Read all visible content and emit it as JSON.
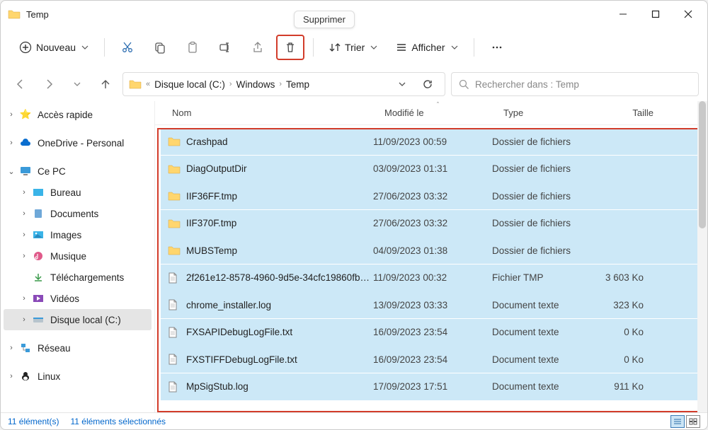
{
  "window": {
    "title": "Temp"
  },
  "tooltip": "Supprimer",
  "toolbar": {
    "new_label": "Nouveau",
    "sort_label": "Trier",
    "view_label": "Afficher"
  },
  "breadcrumb": {
    "prefix": "«",
    "seg1": "Disque local (C:)",
    "seg2": "Windows",
    "seg3": "Temp"
  },
  "search": {
    "placeholder": "Rechercher dans : Temp"
  },
  "sidebar": {
    "quick": "Accès rapide",
    "onedrive": "OneDrive - Personal",
    "thispc": "Ce PC",
    "desktop": "Bureau",
    "documents": "Documents",
    "images": "Images",
    "music": "Musique",
    "downloads": "Téléchargements",
    "videos": "Vidéos",
    "diskc": "Disque local (C:)",
    "network": "Réseau",
    "linux": "Linux"
  },
  "columns": {
    "name": "Nom",
    "modified": "Modifié le",
    "type": "Type",
    "size": "Taille"
  },
  "files": [
    {
      "name": "Crashpad",
      "modified": "11/09/2023 00:59",
      "type": "Dossier de fichiers",
      "size": "",
      "icon": "folder"
    },
    {
      "name": "DiagOutputDir",
      "modified": "03/09/2023 01:31",
      "type": "Dossier de fichiers",
      "size": "",
      "icon": "folder"
    },
    {
      "name": "IIF36FF.tmp",
      "modified": "27/06/2023 03:32",
      "type": "Dossier de fichiers",
      "size": "",
      "icon": "folder"
    },
    {
      "name": "IIF370F.tmp",
      "modified": "27/06/2023 03:32",
      "type": "Dossier de fichiers",
      "size": "",
      "icon": "folder"
    },
    {
      "name": "MUBSTemp",
      "modified": "04/09/2023 01:38",
      "type": "Dossier de fichiers",
      "size": "",
      "icon": "folder"
    },
    {
      "name": "2f261e12-8578-4960-9d5e-34cfc19860fb…",
      "modified": "11/09/2023 00:32",
      "type": "Fichier TMP",
      "size": "3 603 Ko",
      "icon": "file"
    },
    {
      "name": "chrome_installer.log",
      "modified": "13/09/2023 03:33",
      "type": "Document texte",
      "size": "323 Ko",
      "icon": "file"
    },
    {
      "name": "FXSAPIDebugLogFile.txt",
      "modified": "16/09/2023 23:54",
      "type": "Document texte",
      "size": "0 Ko",
      "icon": "file"
    },
    {
      "name": "FXSTIFFDebugLogFile.txt",
      "modified": "16/09/2023 23:54",
      "type": "Document texte",
      "size": "0 Ko",
      "icon": "file"
    },
    {
      "name": "MpSigStub.log",
      "modified": "17/09/2023 17:51",
      "type": "Document texte",
      "size": "911 Ko",
      "icon": "file"
    }
  ],
  "status": {
    "count": "11 élément(s)",
    "selected": "11 éléments sélectionnés"
  }
}
